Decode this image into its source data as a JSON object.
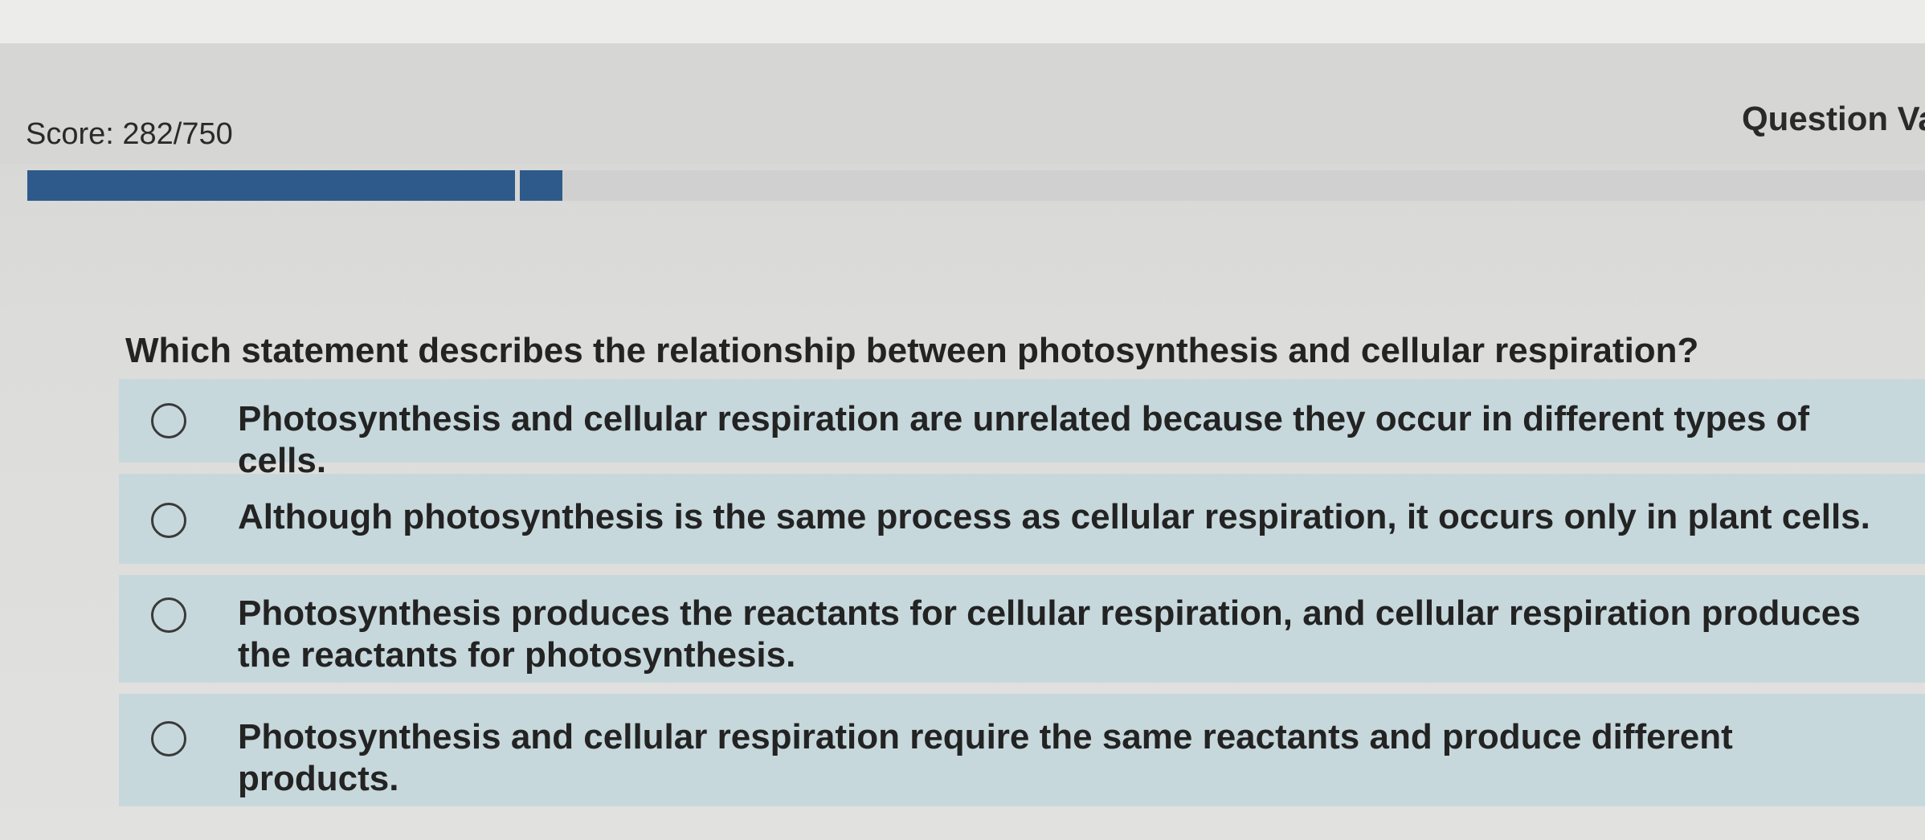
{
  "header": {
    "score_text": "Score: 282/750",
    "question_value_text": "Question Val"
  },
  "progress": {
    "fraction": 0.282,
    "accent": "#2d5a8a"
  },
  "question": {
    "text": "Which statement describes the relationship between photosynthesis and cellular respiration?",
    "options": [
      {
        "label": "Photosynthesis and cellular respiration are unrelated because they occur in different types of cells.",
        "selected": false
      },
      {
        "label": "Although photosynthesis is the same process as cellular respiration, it occurs only in plant cells.",
        "selected": false
      },
      {
        "label": "Photosynthesis produces the reactants for cellular respiration, and cellular respiration produces the reactants for photosynthesis.",
        "selected": false
      },
      {
        "label": "Photosynthesis and cellular respiration require the same reactants and produce different products.",
        "selected": false
      }
    ]
  },
  "colors": {
    "option_background": "#c7d8dc",
    "page_background": "#dcdcda"
  }
}
